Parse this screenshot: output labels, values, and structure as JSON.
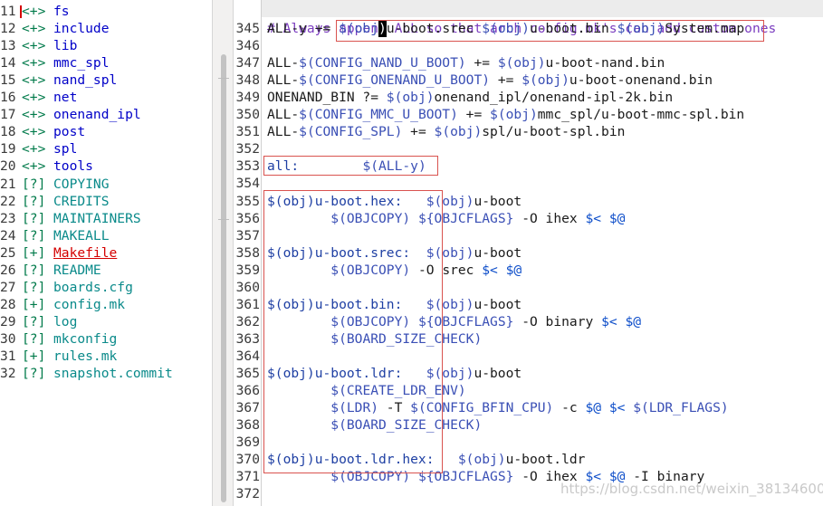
{
  "tree": {
    "items": [
      {
        "ln": "11",
        "tag": "<+>",
        "name": "fs",
        "kind": "dir"
      },
      {
        "ln": "12",
        "tag": "<+>",
        "name": "include",
        "kind": "dir"
      },
      {
        "ln": "13",
        "tag": "<+>",
        "name": "lib",
        "kind": "dir"
      },
      {
        "ln": "14",
        "tag": "<+>",
        "name": "mmc_spl",
        "kind": "dir"
      },
      {
        "ln": "15",
        "tag": "<+>",
        "name": "nand_spl",
        "kind": "dir"
      },
      {
        "ln": "16",
        "tag": "<+>",
        "name": "net",
        "kind": "dir"
      },
      {
        "ln": "17",
        "tag": "<+>",
        "name": "onenand_ipl",
        "kind": "dir"
      },
      {
        "ln": "18",
        "tag": "<+>",
        "name": "post",
        "kind": "dir"
      },
      {
        "ln": "19",
        "tag": "<+>",
        "name": "spl",
        "kind": "dir"
      },
      {
        "ln": "20",
        "tag": "<+>",
        "name": "tools",
        "kind": "dir"
      },
      {
        "ln": "21",
        "tag": "[?]",
        "name": "COPYING",
        "kind": "file"
      },
      {
        "ln": "22",
        "tag": "[?]",
        "name": "CREDITS",
        "kind": "file"
      },
      {
        "ln": "23",
        "tag": "[?]",
        "name": "MAINTAINERS",
        "kind": "file"
      },
      {
        "ln": "24",
        "tag": "[?]",
        "name": "MAKEALL",
        "kind": "file"
      },
      {
        "ln": "25",
        "tag": "[+]",
        "name": "Makefile",
        "kind": "active"
      },
      {
        "ln": "26",
        "tag": "[?]",
        "name": "README",
        "kind": "file"
      },
      {
        "ln": "27",
        "tag": "[?]",
        "name": "boards.cfg",
        "kind": "file"
      },
      {
        "ln": "28",
        "tag": "[+]",
        "name": "config.mk",
        "kind": "file"
      },
      {
        "ln": "29",
        "tag": "[?]",
        "name": "log",
        "kind": "file"
      },
      {
        "ln": "30",
        "tag": "[?]",
        "name": "mkconfig",
        "kind": "file"
      },
      {
        "ln": "31",
        "tag": "[+]",
        "name": "rules.mk",
        "kind": "file"
      },
      {
        "ln": "32",
        "tag": "[?]",
        "name": "snapshot.commit",
        "kind": "file"
      }
    ]
  },
  "editor": {
    "header_comment": "# Always append ALL so that arch config.mk's can add custom ones",
    "lines": [
      {
        "ln": "345",
        "parts": [
          [
            "t",
            "ALL-y += "
          ],
          [
            "v",
            "$(obj"
          ],
          [
            "cur",
            ")"
          ],
          [
            "t",
            "u-boot.srec "
          ],
          [
            "v",
            "$(obj)"
          ],
          [
            "t",
            "u-boot.bin "
          ],
          [
            "v",
            "$(obj)"
          ],
          [
            "t",
            "System.map"
          ]
        ]
      },
      {
        "ln": "346",
        "parts": []
      },
      {
        "ln": "347",
        "parts": [
          [
            "t",
            "ALL-"
          ],
          [
            "v",
            "$(CONFIG_NAND_U_BOOT)"
          ],
          [
            "t",
            " += "
          ],
          [
            "v",
            "$(obj)"
          ],
          [
            "t",
            "u-boot-nand.bin"
          ]
        ]
      },
      {
        "ln": "348",
        "parts": [
          [
            "t",
            "ALL-"
          ],
          [
            "v",
            "$(CONFIG_ONENAND_U_BOOT)"
          ],
          [
            "t",
            " += "
          ],
          [
            "v",
            "$(obj)"
          ],
          [
            "t",
            "u-boot-onenand.bin"
          ]
        ]
      },
      {
        "ln": "349",
        "parts": [
          [
            "t",
            "ONENAND_BIN ?= "
          ],
          [
            "v",
            "$(obj)"
          ],
          [
            "t",
            "onenand_ipl/onenand-ipl-2k.bin"
          ]
        ]
      },
      {
        "ln": "350",
        "parts": [
          [
            "t",
            "ALL-"
          ],
          [
            "v",
            "$(CONFIG_MMC_U_BOOT)"
          ],
          [
            "t",
            " += "
          ],
          [
            "v",
            "$(obj)"
          ],
          [
            "t",
            "mmc_spl/u-boot-mmc-spl.bin"
          ]
        ]
      },
      {
        "ln": "351",
        "parts": [
          [
            "t",
            "ALL-"
          ],
          [
            "v",
            "$(CONFIG_SPL)"
          ],
          [
            "t",
            " += "
          ],
          [
            "v",
            "$(obj)"
          ],
          [
            "t",
            "spl/u-boot-spl.bin"
          ]
        ]
      },
      {
        "ln": "352",
        "parts": []
      },
      {
        "ln": "353",
        "parts": [
          [
            "g",
            "all:"
          ],
          [
            "t",
            "        "
          ],
          [
            "v",
            "$(ALL-y)"
          ]
        ]
      },
      {
        "ln": "354",
        "parts": []
      },
      {
        "ln": "355",
        "parts": [
          [
            "g",
            "$(obj)u-boot.hex:"
          ],
          [
            "t",
            "   "
          ],
          [
            "v",
            "$(obj)"
          ],
          [
            "t",
            "u-boot"
          ]
        ]
      },
      {
        "ln": "356",
        "parts": [
          [
            "t",
            "        "
          ],
          [
            "v",
            "$(OBJCOPY)"
          ],
          [
            "t",
            " "
          ],
          [
            "v",
            "${OBJCFLAGS}"
          ],
          [
            "t",
            " -O ihex "
          ],
          [
            "f",
            "$<"
          ],
          [
            "t",
            " "
          ],
          [
            "f",
            "$@"
          ]
        ]
      },
      {
        "ln": "357",
        "parts": []
      },
      {
        "ln": "358",
        "parts": [
          [
            "g",
            "$(obj)u-boot.srec:"
          ],
          [
            "t",
            "  "
          ],
          [
            "v",
            "$(obj)"
          ],
          [
            "t",
            "u-boot"
          ]
        ]
      },
      {
        "ln": "359",
        "parts": [
          [
            "t",
            "        "
          ],
          [
            "v",
            "$(OBJCOPY)"
          ],
          [
            "t",
            " -O srec "
          ],
          [
            "f",
            "$<"
          ],
          [
            "t",
            " "
          ],
          [
            "f",
            "$@"
          ]
        ]
      },
      {
        "ln": "360",
        "parts": []
      },
      {
        "ln": "361",
        "parts": [
          [
            "g",
            "$(obj)u-boot.bin:"
          ],
          [
            "t",
            "   "
          ],
          [
            "v",
            "$(obj)"
          ],
          [
            "t",
            "u-boot"
          ]
        ]
      },
      {
        "ln": "362",
        "parts": [
          [
            "t",
            "        "
          ],
          [
            "v",
            "$(OBJCOPY)"
          ],
          [
            "t",
            " "
          ],
          [
            "v",
            "${OBJCFLAGS}"
          ],
          [
            "t",
            " -O binary "
          ],
          [
            "f",
            "$<"
          ],
          [
            "t",
            " "
          ],
          [
            "f",
            "$@"
          ]
        ]
      },
      {
        "ln": "363",
        "parts": [
          [
            "t",
            "        "
          ],
          [
            "v",
            "$(BOARD_SIZE_CHECK)"
          ]
        ]
      },
      {
        "ln": "364",
        "parts": []
      },
      {
        "ln": "365",
        "parts": [
          [
            "g",
            "$(obj)u-boot.ldr:"
          ],
          [
            "t",
            "   "
          ],
          [
            "v",
            "$(obj)"
          ],
          [
            "t",
            "u-boot"
          ]
        ]
      },
      {
        "ln": "366",
        "parts": [
          [
            "t",
            "        "
          ],
          [
            "v",
            "$(CREATE_LDR_ENV)"
          ]
        ]
      },
      {
        "ln": "367",
        "parts": [
          [
            "t",
            "        "
          ],
          [
            "v",
            "$(LDR)"
          ],
          [
            "t",
            " -T "
          ],
          [
            "v",
            "$(CONFIG_BFIN_CPU)"
          ],
          [
            "t",
            " -c "
          ],
          [
            "f",
            "$@"
          ],
          [
            "t",
            " "
          ],
          [
            "f",
            "$<"
          ],
          [
            "t",
            " "
          ],
          [
            "v",
            "$(LDR_FLAGS)"
          ]
        ]
      },
      {
        "ln": "368",
        "parts": [
          [
            "t",
            "        "
          ],
          [
            "v",
            "$(BOARD_SIZE_CHECK)"
          ]
        ]
      },
      {
        "ln": "369",
        "parts": []
      },
      {
        "ln": "370",
        "parts": [
          [
            "g",
            "$(obj)u-boot.ldr.hex:"
          ],
          [
            "t",
            "   "
          ],
          [
            "v",
            "$(obj)"
          ],
          [
            "t",
            "u-boot.ldr"
          ]
        ]
      },
      {
        "ln": "371",
        "parts": [
          [
            "t",
            "        "
          ],
          [
            "v",
            "$(OBJCOPY)"
          ],
          [
            "t",
            " "
          ],
          [
            "v",
            "${OBJCFLAGS}"
          ],
          [
            "t",
            " -O ihex "
          ],
          [
            "f",
            "$<"
          ],
          [
            "t",
            " "
          ],
          [
            "f",
            "$@"
          ],
          [
            "t",
            " -I binary"
          ]
        ]
      },
      {
        "ln": "372",
        "parts": []
      }
    ]
  },
  "watermark": "https://blog.csdn.net/weixin_38134600"
}
